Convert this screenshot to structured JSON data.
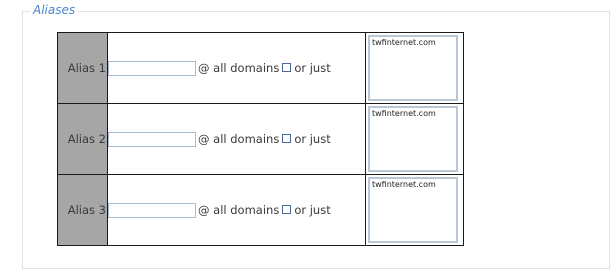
{
  "fieldset": {
    "legend": "Aliases"
  },
  "aliases": [
    {
      "label": "Alias 1",
      "input_value": "",
      "at_text": "@ all domains",
      "or_text": "or just",
      "checked": false,
      "domains": [
        "twfinternet.com"
      ]
    },
    {
      "label": "Alias 2",
      "input_value": "",
      "at_text": "@ all domains",
      "or_text": "or just",
      "checked": false,
      "domains": [
        "twfinternet.com"
      ]
    },
    {
      "label": "Alias 3",
      "input_value": "",
      "at_text": "@ all domains",
      "or_text": "or just",
      "checked": false,
      "domains": [
        "twfinternet.com"
      ]
    }
  ],
  "colors": {
    "legend": "#4a86c8",
    "label_background": "#a6a6a6",
    "table_border": "#1a1a1a",
    "input_border": "#a9bbd3"
  }
}
